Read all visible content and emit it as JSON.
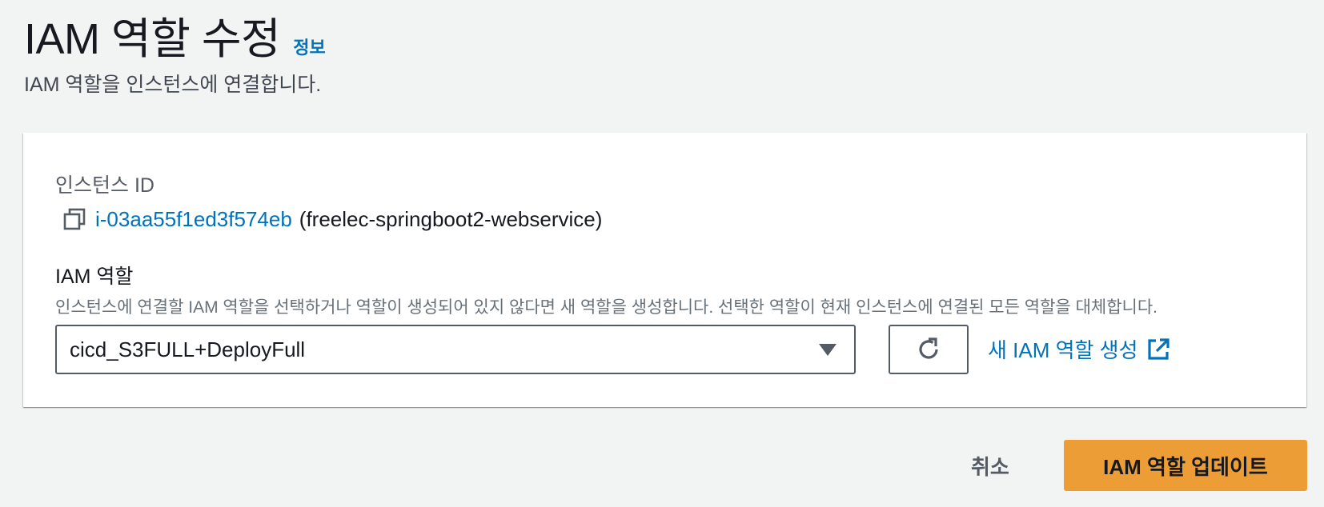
{
  "header": {
    "title": "IAM 역할 수정",
    "info_link": "정보",
    "description": "IAM 역할을 인스턴스에 연결합니다."
  },
  "instance": {
    "label": "인스턴스 ID",
    "id": "i-03aa55f1ed3f574eb",
    "name": "(freelec-springboot2-webservice)"
  },
  "iam_role": {
    "label": "IAM 역할",
    "description": "인스턴스에 연결할 IAM 역할을 선택하거나 역할이 생성되어 있지 않다면 새 역할을 생성합니다. 선택한 역할이 현재 인스턴스에 연결된 모든 역할을 대체합니다.",
    "selected": "cicd_S3FULL+DeployFull",
    "create_link": "새 IAM 역할 생성"
  },
  "actions": {
    "cancel": "취소",
    "submit": "IAM 역할 업데이트"
  },
  "colors": {
    "link": "#0073bb",
    "primary_button": "#ec9d36",
    "background": "#f2f3f3"
  },
  "icons": {
    "copy": "copy-icon",
    "caret": "caret-down-icon",
    "refresh": "refresh-icon",
    "external": "external-link-icon"
  }
}
